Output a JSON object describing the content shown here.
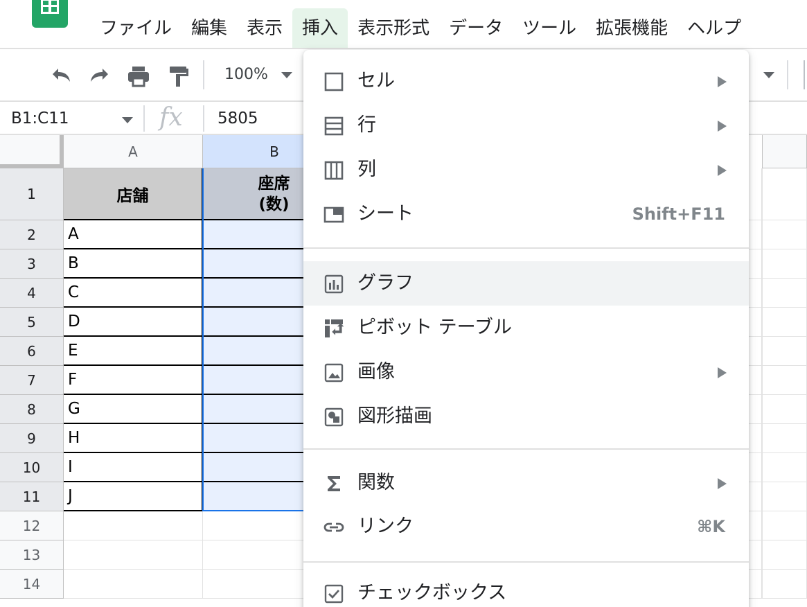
{
  "menubar": {
    "items": [
      "ファイル",
      "編集",
      "表示",
      "挿入",
      "表示形式",
      "データ",
      "ツール",
      "拡張機能",
      "ヘルプ"
    ],
    "active_index": 3
  },
  "toolbar": {
    "zoom": "100%",
    "icons": [
      "undo-icon",
      "redo-icon",
      "print-icon",
      "paint-format-icon"
    ]
  },
  "formula_bar": {
    "name_box": "B1:C11",
    "fx_label": "fx",
    "value": "5805"
  },
  "grid": {
    "columns": [
      "A",
      "B"
    ],
    "rows": [
      "1",
      "2",
      "3",
      "4",
      "5",
      "6",
      "7",
      "8",
      "9",
      "10",
      "11",
      "12",
      "13",
      "14"
    ],
    "header_a": "店舗",
    "header_b": "座席\n(数)",
    "col_a_values": [
      "A",
      "B",
      "C",
      "D",
      "E",
      "F",
      "G",
      "H",
      "I",
      "J"
    ]
  },
  "insert_menu": {
    "items": [
      {
        "label": "セル",
        "icon": "cell-icon",
        "submenu": true,
        "shortcut": ""
      },
      {
        "label": "行",
        "icon": "row-icon",
        "submenu": true,
        "shortcut": ""
      },
      {
        "label": "列",
        "icon": "column-icon",
        "submenu": true,
        "shortcut": ""
      },
      {
        "label": "シート",
        "icon": "sheet-icon",
        "submenu": false,
        "shortcut": "Shift+F11"
      },
      {
        "label": "グラフ",
        "icon": "chart-icon",
        "submenu": false,
        "shortcut": ""
      },
      {
        "label": "ピボット テーブル",
        "icon": "pivot-table-icon",
        "submenu": false,
        "shortcut": ""
      },
      {
        "label": "画像",
        "icon": "image-icon",
        "submenu": true,
        "shortcut": ""
      },
      {
        "label": "図形描画",
        "icon": "drawing-icon",
        "submenu": false,
        "shortcut": ""
      },
      {
        "label": "関数",
        "icon": "sigma-icon",
        "submenu": true,
        "shortcut": ""
      },
      {
        "label": "リンク",
        "icon": "link-icon",
        "submenu": false,
        "shortcut": "⌘K"
      },
      {
        "label": "チェックボックス",
        "icon": "checkbox-icon",
        "submenu": false,
        "shortcut": ""
      }
    ],
    "hover_index": 4
  },
  "colors": {
    "accent": "#1a73e8",
    "logo_green": "#23a566",
    "active_menu_bg": "#e6f4ea",
    "selection_fill": "#e8f0fe"
  }
}
